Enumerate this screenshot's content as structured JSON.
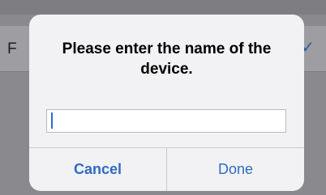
{
  "background": {
    "row_label": "F",
    "row_accessory": "✓"
  },
  "alert": {
    "title": "Please enter the name of the device.",
    "input": {
      "value": "",
      "placeholder": ""
    },
    "buttons": {
      "cancel_label": "Cancel",
      "done_label": "Done"
    }
  },
  "colors": {
    "accent": "#2e6cc0",
    "caret": "#2b6fd6",
    "dim_overlay": "#8a8a8e",
    "alert_background": "#f2f2f4"
  }
}
